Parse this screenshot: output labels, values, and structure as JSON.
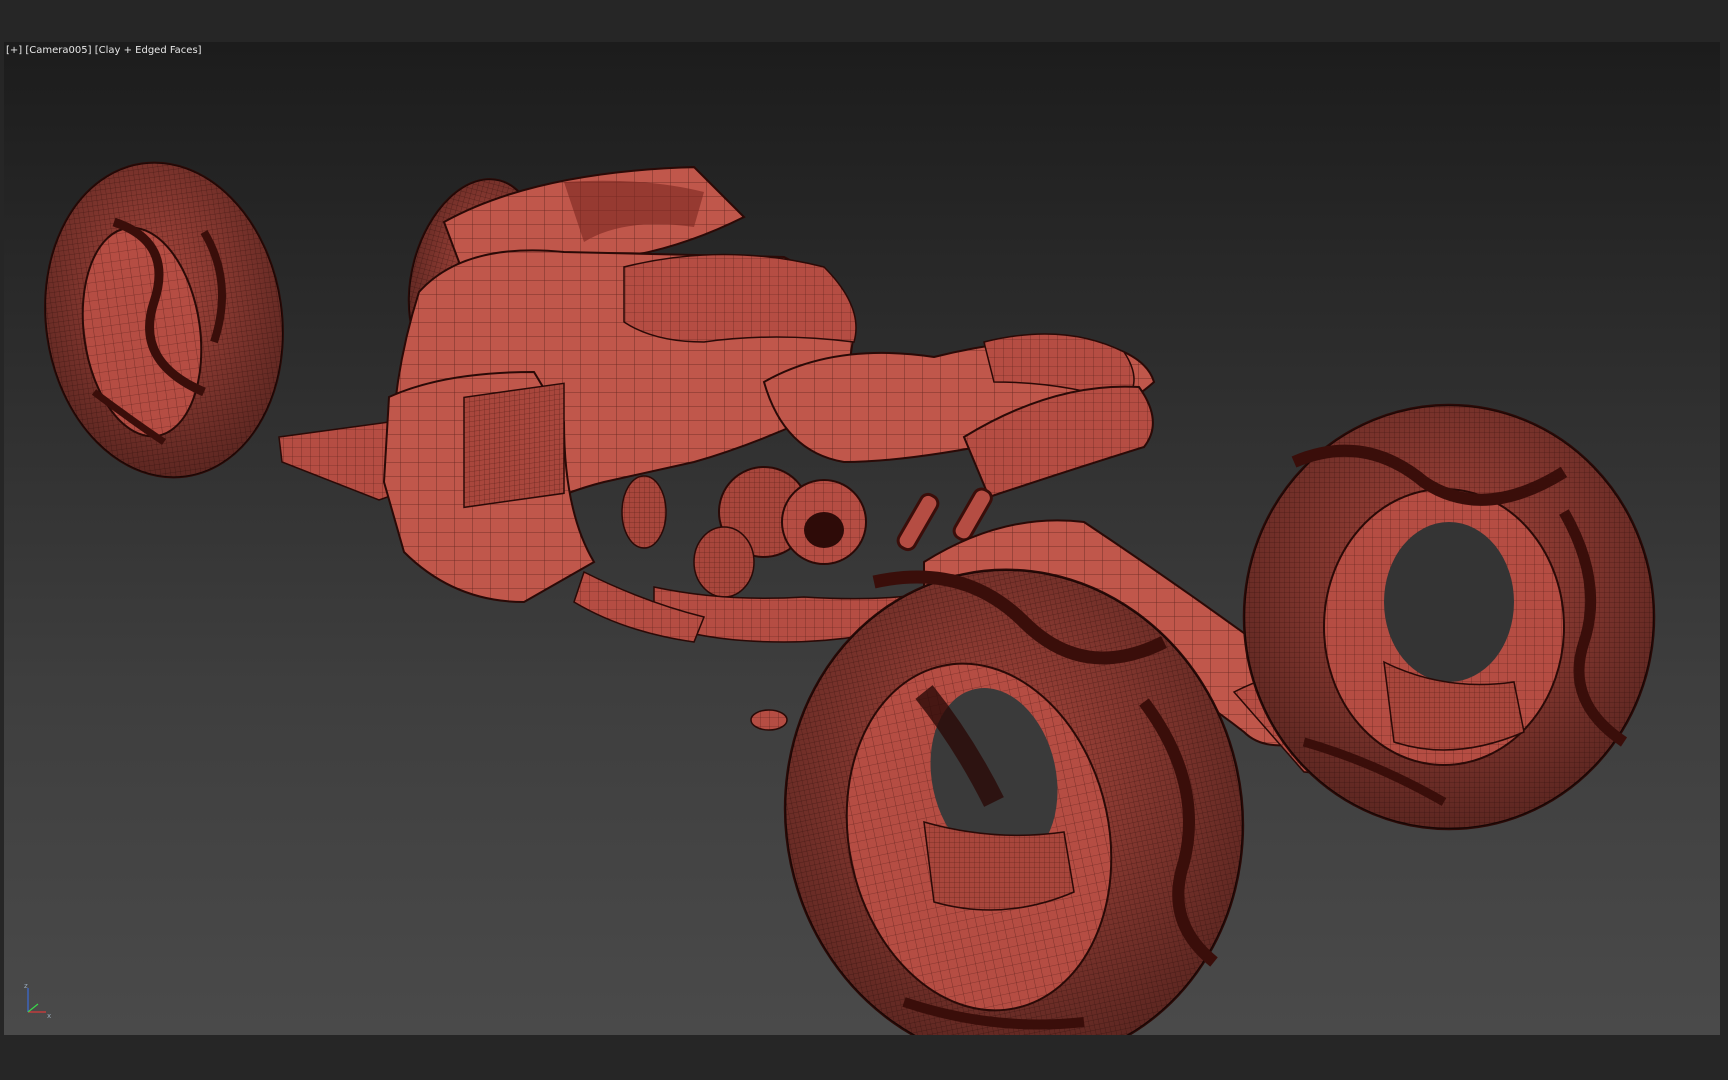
{
  "viewport": {
    "label": {
      "plus": "[+]",
      "camera": "[Camera005]",
      "shading": "[Clay + Edged Faces]"
    },
    "model_color": "#b84f45",
    "background_top": "#1c1c1c",
    "background_bottom": "#4a4a4a",
    "axis_labels": {
      "z": "z",
      "x": "x"
    }
  }
}
